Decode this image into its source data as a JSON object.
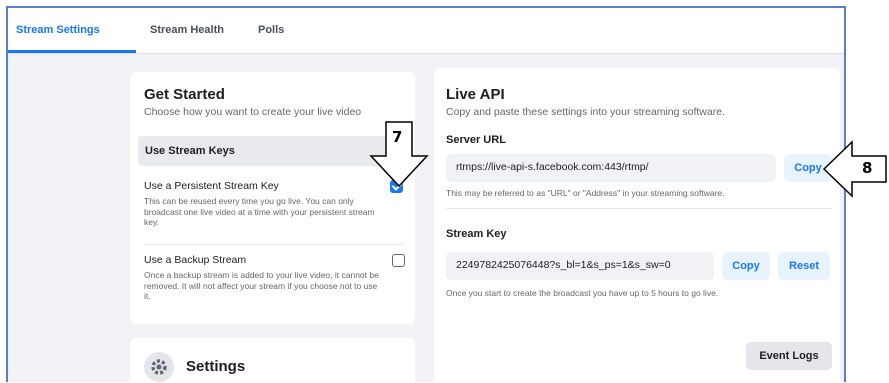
{
  "tabs": [
    "Stream Settings",
    "Stream Health",
    "Polls"
  ],
  "get_started": {
    "title": "Get Started",
    "subtitle": "Choose how you want to create your live video",
    "use_stream_keys": "Use Stream Keys",
    "persistent": {
      "label": "Use a Persistent Stream Key",
      "desc": "This can be reused every time you go live. You can only broadcast one live video at a time with your persistent stream key.",
      "checked": true
    },
    "backup": {
      "label": "Use a Backup Stream",
      "desc": "Once a backup stream is added to your live video, it cannot be removed. It will not affect your stream if you choose not to use it.",
      "checked": false
    }
  },
  "settings": {
    "title": "Settings",
    "icon": "gear-icon"
  },
  "live_api": {
    "title": "Live API",
    "subtitle": "Copy and paste these settings into your streaming software.",
    "server_url_label": "Server URL",
    "server_url_value": "rtmps://live-api-s.facebook.com:443/rtmp/",
    "server_url_note": "This may be referred to as \"URL\" or \"Address\" in your streaming software.",
    "copy_label": "Copy",
    "stream_key_label": "Stream Key",
    "stream_key_value": "2249782425076448?s_bl=1&s_ps=1&s_sw=0",
    "stream_key_copy": "Copy",
    "reset_label": "Reset",
    "stream_key_note": "Once you start to create the broadcast you have up to 5 hours to go live.",
    "event_logs_label": "Event Logs"
  },
  "callouts": {
    "seven": "7",
    "eight": "8"
  },
  "colors": {
    "accent": "#1877f2",
    "frame_border": "#5b7ec4",
    "page_bg": "#f0f2f5"
  }
}
